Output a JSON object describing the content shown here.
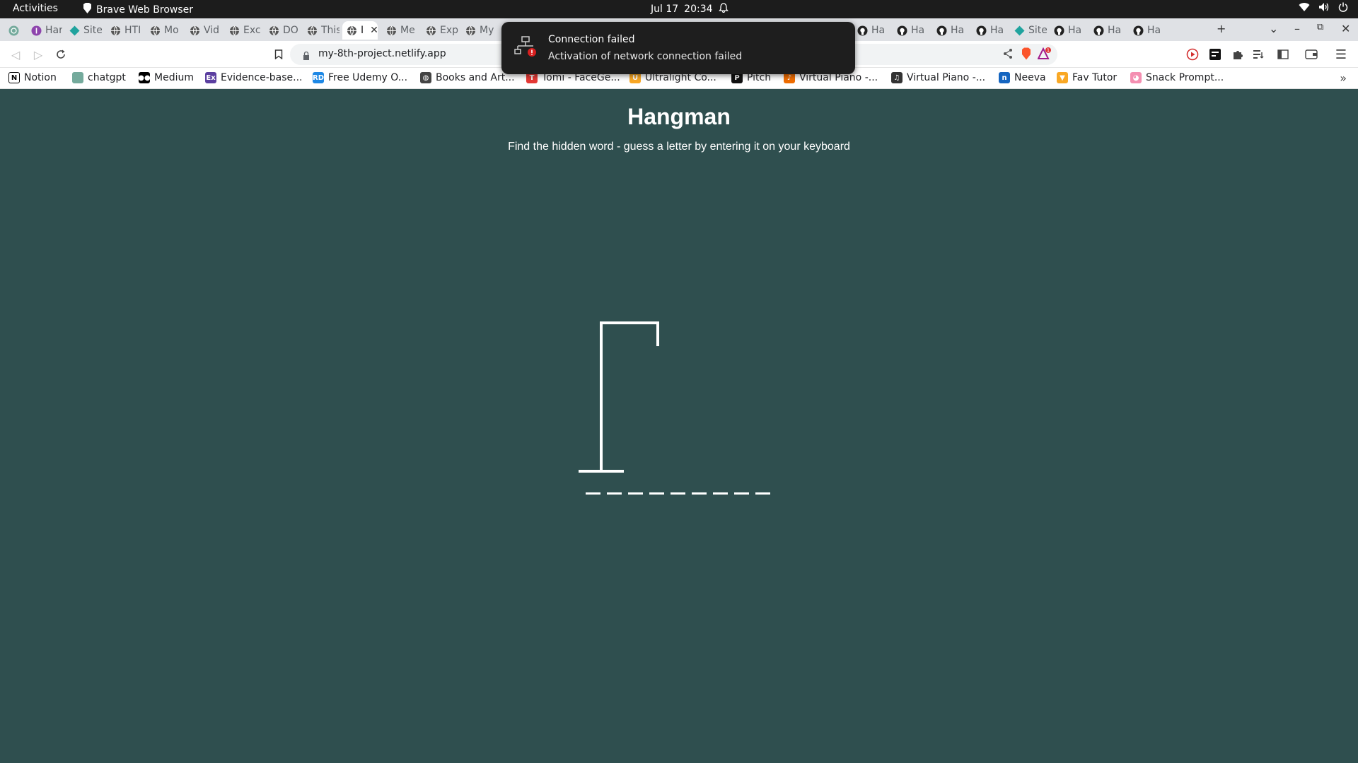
{
  "system_bar": {
    "activities": "Activities",
    "app_name": "Brave Web Browser",
    "date": "Jul 17",
    "time": "20:34"
  },
  "tabs": [
    {
      "label": "",
      "icon": "chatgpt-icon"
    },
    {
      "label": "Har",
      "icon": "purple-circle-icon"
    },
    {
      "label": "Site",
      "icon": "netlify-diamond-icon"
    },
    {
      "label": "HTI",
      "icon": "globe-icon"
    },
    {
      "label": "Mo",
      "icon": "globe-icon"
    },
    {
      "label": "Vid",
      "icon": "globe-icon"
    },
    {
      "label": "Exc",
      "icon": "globe-icon"
    },
    {
      "label": "DO",
      "icon": "globe-icon"
    },
    {
      "label": "This",
      "icon": "globe-icon"
    },
    {
      "label": "I",
      "icon": "globe-icon",
      "active": true
    },
    {
      "label": "Me",
      "icon": "globe-icon"
    },
    {
      "label": "Exp",
      "icon": "globe-icon"
    },
    {
      "label": "My",
      "icon": "globe-icon"
    },
    {
      "label": "Ha",
      "icon": "github-icon"
    },
    {
      "label": "Ha",
      "icon": "github-icon"
    },
    {
      "label": "Ha",
      "icon": "github-icon"
    },
    {
      "label": "Ha",
      "icon": "github-icon"
    },
    {
      "label": "Site",
      "icon": "netlify-diamond-icon"
    },
    {
      "label": "Ha",
      "icon": "github-icon"
    },
    {
      "label": "Ha",
      "icon": "github-icon"
    },
    {
      "label": "Ha",
      "icon": "github-icon"
    }
  ],
  "address_bar": {
    "url": "my-8th-project.netlify.app",
    "rewards_badge": "1"
  },
  "bookmarks": [
    {
      "label": "Notion",
      "icon": "notion-icon"
    },
    {
      "label": "chatgpt",
      "icon": "chatgpt-icon"
    },
    {
      "label": "Medium",
      "icon": "medium-icon"
    },
    {
      "label": "Evidence-base...",
      "icon": "ex-icon"
    },
    {
      "label": "Free Udemy O...",
      "icon": "rd-icon"
    },
    {
      "label": "Books and Art...",
      "icon": "globe-icon"
    },
    {
      "label": "Tomi - FaceGe...",
      "icon": "tomi-icon"
    },
    {
      "label": "Ultralight Co...",
      "icon": "ultralight-icon"
    },
    {
      "label": "Pitch",
      "icon": "pitch-icon"
    },
    {
      "label": "Virtual Piano -...",
      "icon": "piano-icon"
    },
    {
      "label": "Virtual Piano -...",
      "icon": "piano-round-icon"
    },
    {
      "label": "Neeva",
      "icon": "neeva-icon"
    },
    {
      "label": "Fav Tutor",
      "icon": "favtutor-icon"
    },
    {
      "label": "Snack Prompt...",
      "icon": "snack-icon"
    }
  ],
  "page": {
    "title": "Hangman",
    "subtitle": "Find the hidden word - guess a letter by entering it on your keyboard",
    "hidden_word_length": 9
  },
  "notification": {
    "title": "Connection failed",
    "body": "Activation of network connection failed"
  },
  "colors": {
    "page_background": "#2f4f4f",
    "drawing": "#ffffff",
    "toast_background": "#1e1e1e"
  }
}
